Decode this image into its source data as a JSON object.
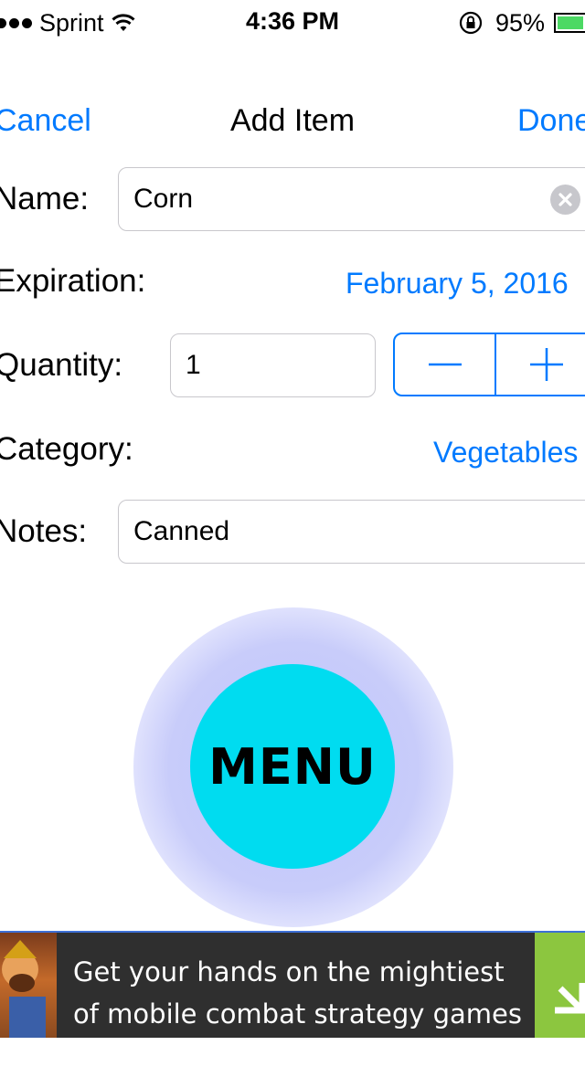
{
  "status_bar": {
    "carrier": "Sprint",
    "time": "4:36 PM",
    "battery_percent": "95%",
    "battery_level": 0.95,
    "icons": [
      "signal-dots-icon",
      "wifi-icon",
      "rotation-lock-icon",
      "battery-icon"
    ]
  },
  "nav": {
    "cancel_label": "Cancel",
    "title": "Add Item",
    "done_label": "Done"
  },
  "form": {
    "name_label": "Name:",
    "name_value": "Corn",
    "expiration_label": "Expiration:",
    "expiration_value": "February 5, 2016",
    "quantity_label": "Quantity:",
    "quantity_value": "1",
    "category_label": "Category:",
    "category_value": "Vegetables",
    "notes_label": "Notes:",
    "notes_value": "Canned"
  },
  "menu": {
    "label": "MENU"
  },
  "ad": {
    "text": "Get your hands on the mightiest of mobile combat strategy games—"
  },
  "colors": {
    "accent": "#007aff",
    "menu_button": "#00dcf0",
    "battery": "#4cd964",
    "ad_background": "#2f2f2f",
    "ad_download": "#8cc63f"
  }
}
